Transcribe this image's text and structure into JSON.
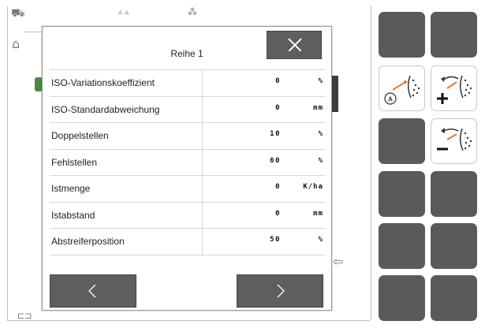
{
  "dialog": {
    "title": "Reihe 1",
    "rows": [
      {
        "label": "ISO-Variationskoeffizient",
        "value": "0",
        "unit": "%"
      },
      {
        "label": "ISO-Standardabweichung",
        "value": "0",
        "unit": "mm"
      },
      {
        "label": "Doppelstellen",
        "value": "10",
        "unit": "%"
      },
      {
        "label": "Fehlstellen",
        "value": "60",
        "unit": "%"
      },
      {
        "label": "Istmenge",
        "value": "0",
        "unit": "K/ha"
      },
      {
        "label": "Istabstand",
        "value": "0",
        "unit": "mm"
      },
      {
        "label": "Abstreiferposition",
        "value": "50",
        "unit": "%"
      }
    ],
    "buttons": {
      "close_icon": "close-icon",
      "prev_icon": "chevron-left-icon",
      "next_icon": "chevron-right-icon"
    }
  },
  "side_panel": {
    "buttons": [
      {
        "name": "side-button-1-1",
        "icon": ""
      },
      {
        "name": "side-button-1-2",
        "icon": ""
      },
      {
        "name": "side-button-2-1",
        "icon": "auto-seeding-icon"
      },
      {
        "name": "side-button-2-2",
        "icon": "seeding-increase-icon"
      },
      {
        "name": "side-button-3-1",
        "icon": ""
      },
      {
        "name": "side-button-3-2",
        "icon": "seeding-decrease-icon"
      },
      {
        "name": "side-button-4-1",
        "icon": ""
      },
      {
        "name": "side-button-4-2",
        "icon": ""
      },
      {
        "name": "side-button-5-1",
        "icon": ""
      },
      {
        "name": "side-button-5-2",
        "icon": ""
      },
      {
        "name": "side-button-6-1",
        "icon": ""
      },
      {
        "name": "side-button-6-2",
        "icon": ""
      }
    ]
  },
  "colors": {
    "button_dark": "#5a5a5a",
    "accent_orange": "#e07a3a",
    "background": "#ffffff"
  }
}
